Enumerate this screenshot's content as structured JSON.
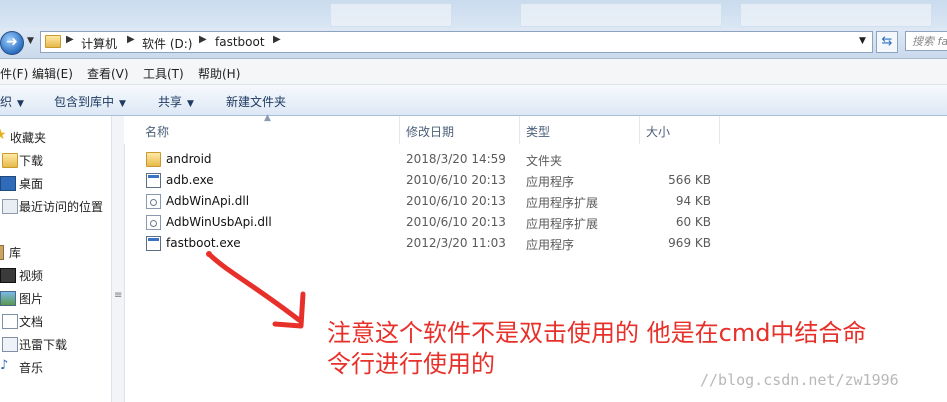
{
  "address": {
    "crumbs": [
      "计算机",
      "软件 (D:)",
      "fastboot"
    ],
    "search_placeholder": "搜索 fas"
  },
  "menu": [
    "件(F)",
    "编辑(E)",
    "查看(V)",
    "工具(T)",
    "帮助(H)"
  ],
  "toolbar": [
    "织",
    "包含到库中",
    "共享",
    "新建文件夹"
  ],
  "nav": {
    "favorites": "收藏夹",
    "downloads": "下载",
    "desktop": "桌面",
    "recent": "最近访问的位置",
    "libraries": "库",
    "videos": "视频",
    "pictures": "图片",
    "documents": "文档",
    "thunder": "迅雷下载",
    "music": "音乐"
  },
  "columns": {
    "name": "名称",
    "date": "修改日期",
    "type": "类型",
    "size": "大小"
  },
  "files": [
    {
      "name": "android",
      "date": "2018/3/20 14:59",
      "type": "文件夹",
      "size": "",
      "icon": "folder-icon"
    },
    {
      "name": "adb.exe",
      "date": "2010/6/10 20:13",
      "type": "应用程序",
      "size": "566 KB",
      "icon": "exe-icon"
    },
    {
      "name": "AdbWinApi.dll",
      "date": "2010/6/10 20:13",
      "type": "应用程序扩展",
      "size": "94 KB",
      "icon": "dll-icon"
    },
    {
      "name": "AdbWinUsbApi.dll",
      "date": "2010/6/10 20:13",
      "type": "应用程序扩展",
      "size": "60 KB",
      "icon": "dll-icon"
    },
    {
      "name": "fastboot.exe",
      "date": "2012/3/20 11:03",
      "type": "应用程序",
      "size": "969 KB",
      "icon": "exe-icon"
    }
  ],
  "annotation": {
    "line1": "注意这个软件不是双击使用的 他是在cmd中结合命",
    "line2": "令行进行使用的",
    "color": "#e8302a"
  },
  "watermark": "//blog.csdn.net/zw1996"
}
